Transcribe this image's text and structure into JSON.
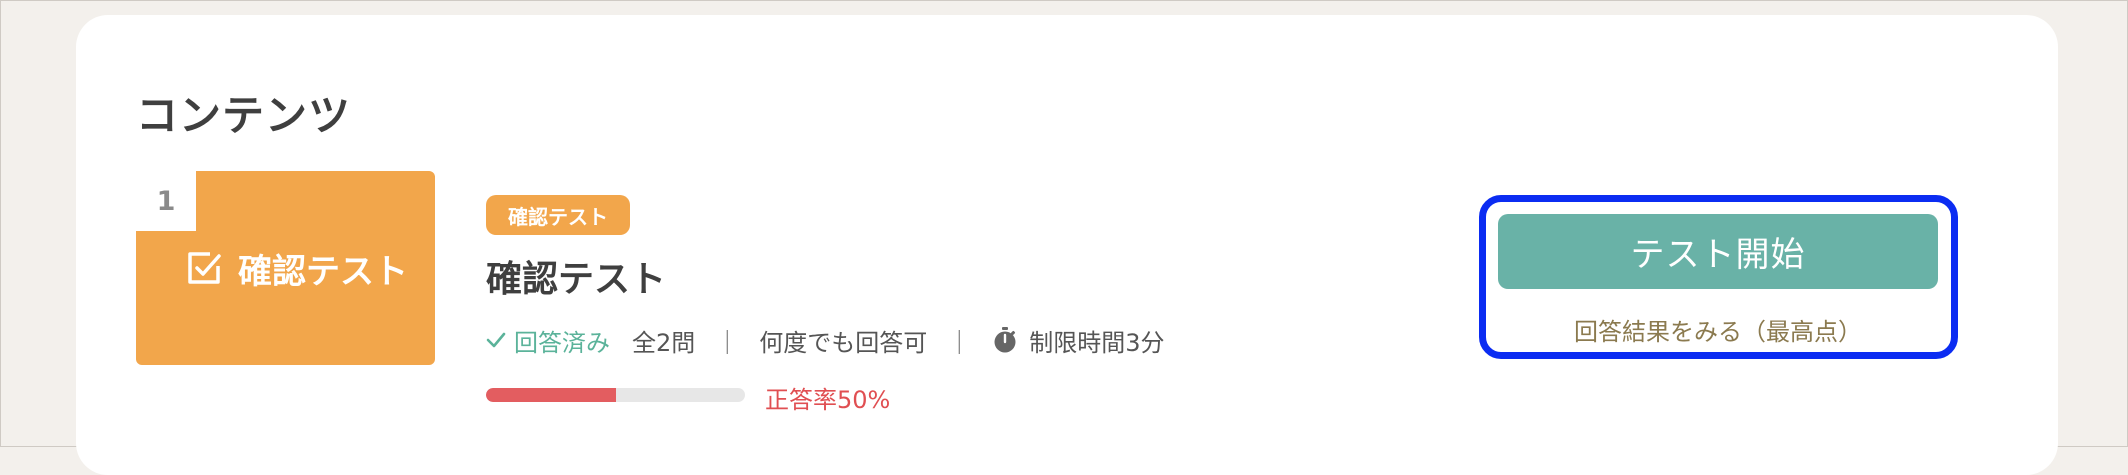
{
  "section": {
    "title": "コンテンツ"
  },
  "item": {
    "number": "1",
    "thumbnail_label": "確認テスト",
    "tag": "確認テスト",
    "title": "確認テスト",
    "status": "回答済み",
    "question_count": "全2問",
    "separator": "｜",
    "retry": "何度でも回答可",
    "time_limit": "制限時間3分",
    "progress_fraction": 0.5,
    "score_label": "正答率50%"
  },
  "actions": {
    "start_label": "テスト開始",
    "result_label": "回答結果をみる（最高点）"
  },
  "colors": {
    "thumbnail": "#f2a64b",
    "accent_green": "#69b2a7",
    "status_green": "#5bb39a",
    "progress_red": "#e35d60",
    "highlight_blue": "#0b2cf2",
    "link_brown": "#8b7a4f"
  },
  "icons": {
    "thumbnail": "checkbox-edit-icon",
    "status": "check-icon",
    "time": "stopwatch-icon"
  }
}
